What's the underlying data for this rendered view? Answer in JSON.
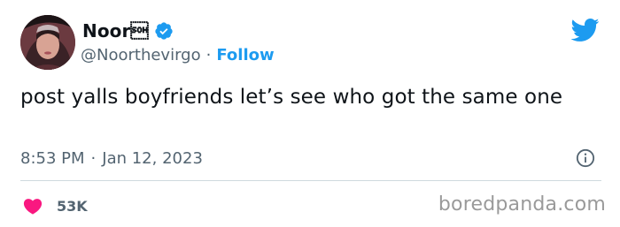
{
  "author": {
    "display_name": "Noor\u0001",
    "handle": "@Noorthevirgo",
    "separator": "·",
    "follow_label": "Follow",
    "verified": true
  },
  "tweet": {
    "text": "post yalls boyfriends let’s see who got the same one",
    "time": "8:53 PM",
    "time_separator": "·",
    "date": "Jan 12, 2023"
  },
  "engagement": {
    "likes": "53K"
  },
  "watermark": "boredpanda.com",
  "icons": {
    "brand": "twitter-bird-icon",
    "verified": "verified-badge-icon",
    "info": "info-icon",
    "like": "heart-icon"
  },
  "colors": {
    "accent": "#1d9bf0",
    "heart": "#f91880",
    "secondary_text": "#536471",
    "divider": "#cfd9de"
  }
}
